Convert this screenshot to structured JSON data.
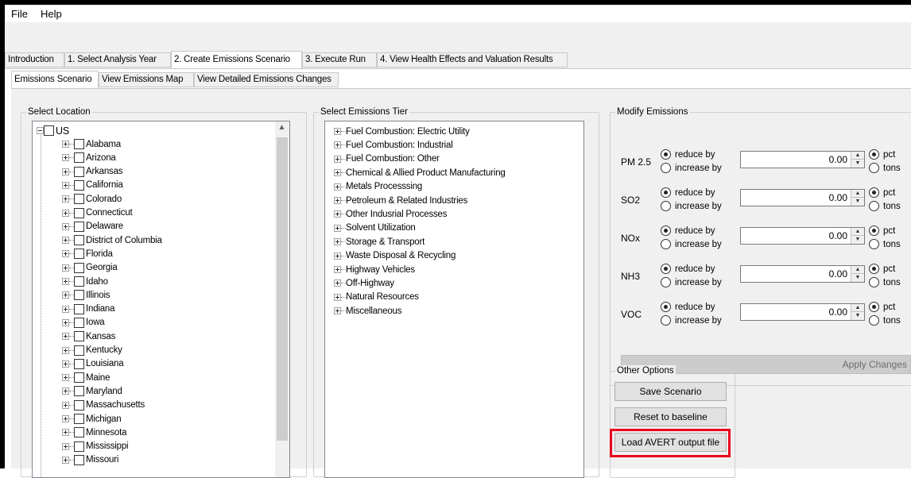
{
  "menu": [
    "File",
    "Help"
  ],
  "main_tabs": [
    "Introduction",
    "1. Select Analysis Year",
    "2. Create Emissions Scenario",
    "3. Execute Run",
    "4. View Health Effects and Valuation Results"
  ],
  "sub_tabs": [
    "Emissions Scenario",
    "View Emissions Map",
    "View Detailed Emissions Changes"
  ],
  "location": {
    "title": "Select Location",
    "root": "US",
    "states": [
      "Alabama",
      "Arizona",
      "Arkansas",
      "California",
      "Colorado",
      "Connecticut",
      "Delaware",
      "District of Columbia",
      "Florida",
      "Georgia",
      "Idaho",
      "Illinois",
      "Indiana",
      "Iowa",
      "Kansas",
      "Kentucky",
      "Louisiana",
      "Maine",
      "Maryland",
      "Massachusetts",
      "Michigan",
      "Minnesota",
      "Mississippi",
      "Missouri"
    ]
  },
  "tier": {
    "title": "Select Emissions Tier",
    "items": [
      "Fuel Combustion: Electric Utility",
      "Fuel Combustion: Industrial",
      "Fuel Combustion: Other",
      "Chemical & Allied Product Manufacturing",
      "Metals Processsing",
      "Petroleum & Related Industries",
      "Other Indusrial Processes",
      "Solvent Utilization",
      "Storage & Transport",
      "Waste Disposal & Recycling",
      "Highway Vehicles",
      "Off-Highway",
      "Natural Resources",
      "Miscellaneous"
    ]
  },
  "modify": {
    "title": "Modify Emissions",
    "reduce_label": "reduce by",
    "increase_label": "increase by",
    "pct_label": "pct",
    "tons_label": "tons",
    "pollutants": [
      {
        "name": "PM 2.5",
        "value": "0.00"
      },
      {
        "name": "SO2",
        "value": "0.00"
      },
      {
        "name": "NOx",
        "value": "0.00"
      },
      {
        "name": "NH3",
        "value": "0.00"
      },
      {
        "name": "VOC",
        "value": "0.00"
      }
    ],
    "apply_label": "Apply Changes"
  },
  "other_options": {
    "title": "Other Options",
    "save": "Save Scenario",
    "reset": "Reset to baseline",
    "load": "Load AVERT output file"
  },
  "colors": {
    "highlight": "#e8001c"
  }
}
